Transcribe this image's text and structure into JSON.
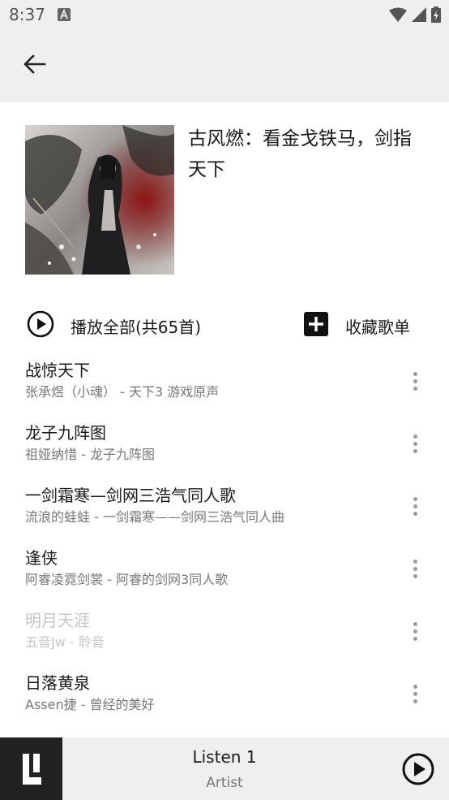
{
  "status_bar": {
    "time": "8:37"
  },
  "app_bar": {
    "back_icon": "arrow-left-icon"
  },
  "playlist": {
    "title": "古风燃：看金戈铁马，剑指天下",
    "play_all_label": "播放全部(共65首)",
    "collect_label": "收藏歌单"
  },
  "songs": [
    {
      "title": "战惊天下",
      "subtitle": "张承煜（小魂） - 天下3 游戏原声",
      "disabled": false
    },
    {
      "title": "龙子九阵图",
      "subtitle": "祖娅纳惜 - 龙子九阵图",
      "disabled": false
    },
    {
      "title": "一剑霜寒—剑网三浩气同人歌",
      "subtitle": "流浪的蛙蛙 - 一剑霜寒——剑网三浩气同人曲",
      "disabled": false
    },
    {
      "title": "逢侠",
      "subtitle": "阿睿凌霓剑裳 - 阿睿的剑网3同人歌",
      "disabled": false
    },
    {
      "title": "明月天涯",
      "subtitle": "五音Jw - 聆音",
      "disabled": true
    },
    {
      "title": "日落黄泉",
      "subtitle": "Assen捷 - 曾经的美好",
      "disabled": false
    }
  ],
  "player": {
    "title": "Listen 1",
    "artist": "Artist"
  },
  "colors": {
    "bar_background": "#efefef",
    "disabled_text": "#c6c6c6",
    "secondary_text": "#777777"
  }
}
